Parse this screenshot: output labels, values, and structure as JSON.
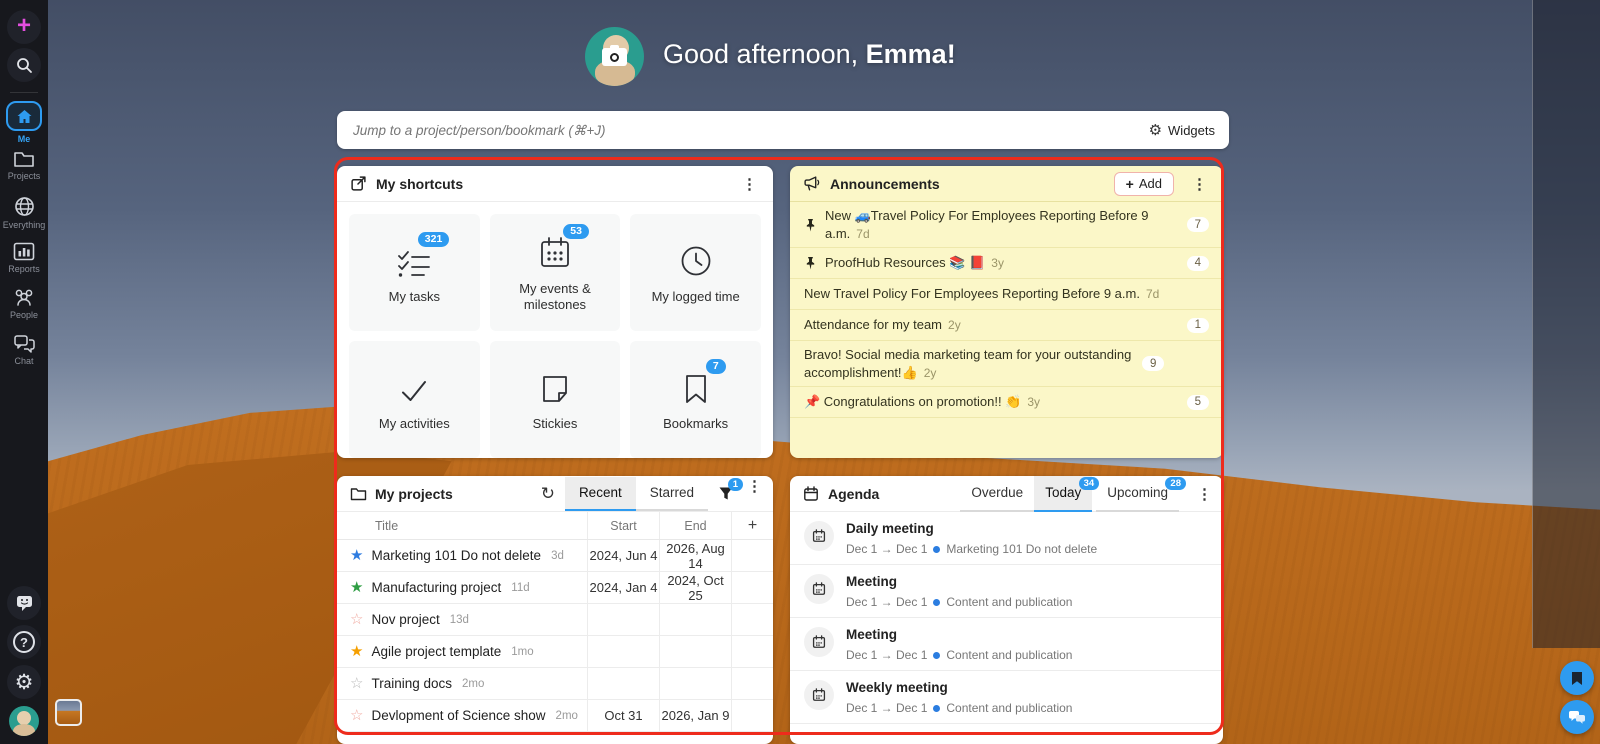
{
  "colors": {
    "accent_blue": "#2e9bf0",
    "annotation_red": "#ee2b1c",
    "announcement_bg": "#fbf7c8",
    "sidebar_bg": "#17181d",
    "active_nav": "#35a3f5",
    "plus_pink": "#e44ee0"
  },
  "left_sidebar": {
    "icons": [
      "plus-icon",
      "search-icon",
      "home-icon",
      "folder-icon",
      "globe-icon",
      "bar-chart-icon",
      "people-icon",
      "chat-icon",
      "feedback-smiley-icon",
      "help-icon",
      "gear-icon",
      "user-avatar"
    ],
    "items": {
      "me": "Me",
      "projects": "Projects",
      "everything": "Everything",
      "reports": "Reports",
      "people": "People",
      "chat": "Chat"
    },
    "help_glyph": "?"
  },
  "greeting": {
    "prefix": "Good afternoon, ",
    "name": "Emma!"
  },
  "search": {
    "placeholder": "Jump to a project/person/bookmark (⌘+J)",
    "widgets_label": "Widgets"
  },
  "shortcuts": {
    "title": "My shortcuts",
    "tiles": [
      {
        "label": "My tasks",
        "badge": "321",
        "icon": "task-list-icon"
      },
      {
        "label": "My events & milestones",
        "badge": "53",
        "icon": "calendar-icon"
      },
      {
        "label": "My logged time",
        "badge": "",
        "icon": "clock-icon"
      },
      {
        "label": "My activities",
        "badge": "",
        "icon": "checkmark-icon"
      },
      {
        "label": "Stickies",
        "badge": "",
        "icon": "sticky-note-icon"
      },
      {
        "label": "Bookmarks",
        "badge": "7",
        "icon": "bookmark-icon"
      }
    ]
  },
  "announcements": {
    "title": "Announcements",
    "add_label": "Add",
    "add_plus": "+",
    "items": [
      {
        "pinned": true,
        "text": "New 🚙Travel Policy For Employees Reporting Before 9 a.m.",
        "age": "7d",
        "count": "7"
      },
      {
        "pinned": true,
        "text": "ProofHub Resources 📚 📕",
        "age": "3y",
        "count": "4"
      },
      {
        "pinned": false,
        "text": "New Travel Policy For Employees Reporting Before 9 a.m.",
        "age": "7d",
        "count": ""
      },
      {
        "pinned": false,
        "text": "Attendance for my team",
        "age": "2y",
        "count": "1"
      },
      {
        "pinned": false,
        "text": "Bravo! Social media marketing team for your outstanding accomplishment!👍",
        "age": "2y",
        "count": "9"
      },
      {
        "pinned": false,
        "text": "📌 Congratulations on promotion!! 👏",
        "age": "3y",
        "count": "5"
      }
    ]
  },
  "projects": {
    "title": "My projects",
    "refresh_glyph": "↻",
    "tabs": {
      "recent": "Recent",
      "starred": "Starred"
    },
    "filter_badge": "1",
    "columns": {
      "title": "Title",
      "start": "Start",
      "end": "End",
      "add": "+"
    },
    "rows": [
      {
        "star": "blue",
        "title": "Marketing 101 Do not delete",
        "age": "3d",
        "start": "2024, Jun 4",
        "end": "2026, Aug 14"
      },
      {
        "star": "green",
        "title": "Manufacturing project",
        "age": "11d",
        "start": "2024, Jan 4",
        "end": "2024, Oct 25"
      },
      {
        "star": "pink-outline",
        "title": "Nov project",
        "age": "13d",
        "start": "",
        "end": ""
      },
      {
        "star": "orange",
        "title": "Agile project template",
        "age": "1mo",
        "start": "",
        "end": ""
      },
      {
        "star": "gray-outline",
        "title": "Training docs",
        "age": "2mo",
        "start": "",
        "end": ""
      },
      {
        "star": "pink-outline",
        "title": "Devlopment of Science show",
        "age": "2mo",
        "start": "Oct 31",
        "end": "2026, Jan 9"
      }
    ]
  },
  "agenda": {
    "title": "Agenda",
    "tabs": [
      {
        "label": "Overdue",
        "badge": ""
      },
      {
        "label": "Today",
        "badge": "34"
      },
      {
        "label": "Upcoming",
        "badge": "28"
      }
    ],
    "items": [
      {
        "title": "Daily meeting",
        "range": "Dec 1 → Dec 1",
        "project": "Marketing 101 Do not delete"
      },
      {
        "title": "Meeting",
        "range": "Dec 1 → Dec 1",
        "project": "Content and publication"
      },
      {
        "title": "Meeting",
        "range": "Dec 1 → Dec 1",
        "project": "Content and publication"
      },
      {
        "title": "Weekly meeting",
        "range": "Dec 1 → Dec 1",
        "project": "Content and publication"
      }
    ]
  },
  "right_sidebar": {
    "icons": [
      "bell-icon",
      "sticky-note-icon",
      "bookmark-icon",
      "megaphone-icon",
      "calendar-icon",
      "clock-icon"
    ]
  },
  "floating_buttons": {
    "icons": [
      "bookmark-icon",
      "chat-icon"
    ]
  }
}
